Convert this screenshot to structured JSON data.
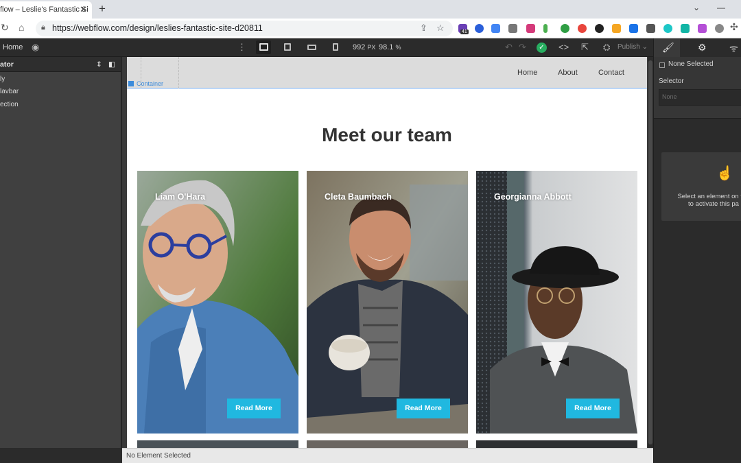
{
  "browser": {
    "tab_title": "flow – Leslie's Fantastic Si",
    "tab_close": "✕",
    "new_tab": "+",
    "url": "https://webflow.com/design/leslies-fantastic-site-d20811",
    "extension_badge": "41"
  },
  "webflow_toolbar": {
    "home_label": "Home",
    "width_value": "992",
    "width_unit": "PX",
    "zoom_value": "98.1",
    "zoom_unit": "%",
    "publish_label": "Publish"
  },
  "navigator": {
    "title": "ator",
    "items": [
      "ly",
      "lavbar",
      "ection"
    ]
  },
  "site": {
    "nav_links": [
      "Home",
      "About",
      "Contact"
    ],
    "container_label": "Container",
    "heading": "Meet our team",
    "read_more_label": "Read More",
    "team": [
      {
        "name": "Liam O'Hara"
      },
      {
        "name": "Cleta Baumbach"
      },
      {
        "name": "Georgianna Abbott"
      }
    ]
  },
  "status_bar": {
    "text": "No Element Selected"
  },
  "style_panel": {
    "none_selected": "None Selected",
    "selector_label": "Selector",
    "selector_placeholder": "None",
    "hint_line1": "Select an element on the",
    "hint_line2": "to activate this pa"
  },
  "colors": {
    "accent_button": "#20b8e0",
    "selection_blue": "#3b8bdb",
    "panel_dark": "#2b2b2b"
  }
}
